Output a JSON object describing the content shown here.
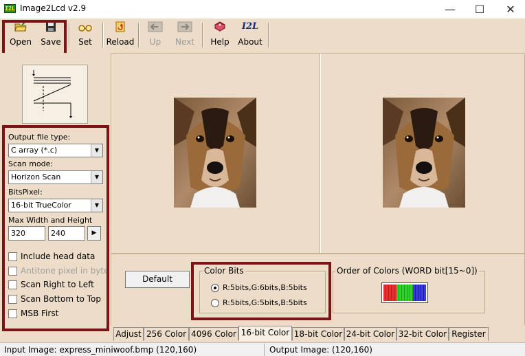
{
  "window": {
    "title": "Image2Lcd v2.9",
    "app_icon_text": "I2L",
    "minimize": "—",
    "maximize": "☐",
    "close": "✕"
  },
  "toolbar": {
    "open": "Open",
    "save": "Save",
    "set": "Set",
    "reload": "Reload",
    "up": "Up",
    "next": "Next",
    "help": "Help",
    "about": "About",
    "about_logo": "I2L"
  },
  "left_panel": {
    "output_file_type_label": "Output file type:",
    "output_file_type_value": "C array (*.c)",
    "scan_mode_label": "Scan mode:",
    "scan_mode_value": "Horizon Scan",
    "bits_pixel_label": "BitsPixel:",
    "bits_pixel_value": "16-bit TrueColor",
    "max_size_label": "Max Width and Height",
    "max_width": "320",
    "max_height": "240",
    "checkboxes": [
      {
        "label": "Include head data",
        "checked": false,
        "enabled": true
      },
      {
        "label": "Antitone pixel in byte",
        "checked": false,
        "enabled": false
      },
      {
        "label": "Scan Right to Left",
        "checked": false,
        "enabled": true
      },
      {
        "label": "Scan Bottom to Top",
        "checked": false,
        "enabled": true
      },
      {
        "label": "MSB First",
        "checked": false,
        "enabled": true
      }
    ]
  },
  "color_panel": {
    "default_button": "Default",
    "color_bits_title": "Color Bits",
    "color_bits_options": [
      {
        "label": "R:5bits,G:6bits,B:5bits",
        "selected": true
      },
      {
        "label": "R:5bits,G:5bits,B:5bits",
        "selected": false
      }
    ],
    "order_title": "Order of Colors (WORD bit[15~0])",
    "order_colors": [
      "#e53030",
      "#2ed12e",
      "#3a3ae0"
    ]
  },
  "tabs": [
    {
      "label": "Adjust",
      "active": false
    },
    {
      "label": "256 Color",
      "active": false
    },
    {
      "label": "4096 Color",
      "active": false
    },
    {
      "label": "16-bit Color",
      "active": true
    },
    {
      "label": "18-bit Color",
      "active": false
    },
    {
      "label": "24-bit Color",
      "active": false
    },
    {
      "label": "32-bit Color",
      "active": false
    },
    {
      "label": "Register",
      "active": false
    }
  ],
  "status": {
    "input": "Input Image: express_miniwoof.bmp (120,160)",
    "output": "Output Image: (120,160)"
  },
  "icons": {
    "open": "folder-open-icon",
    "save": "floppy-disk-icon",
    "set": "glasses-icon",
    "reload": "reload-icon",
    "up": "left-arrow-icon",
    "next": "right-arrow-icon",
    "help": "help-book-icon",
    "about": "i2l-logo-icon",
    "scan_mode": "scan-pattern-icon"
  }
}
